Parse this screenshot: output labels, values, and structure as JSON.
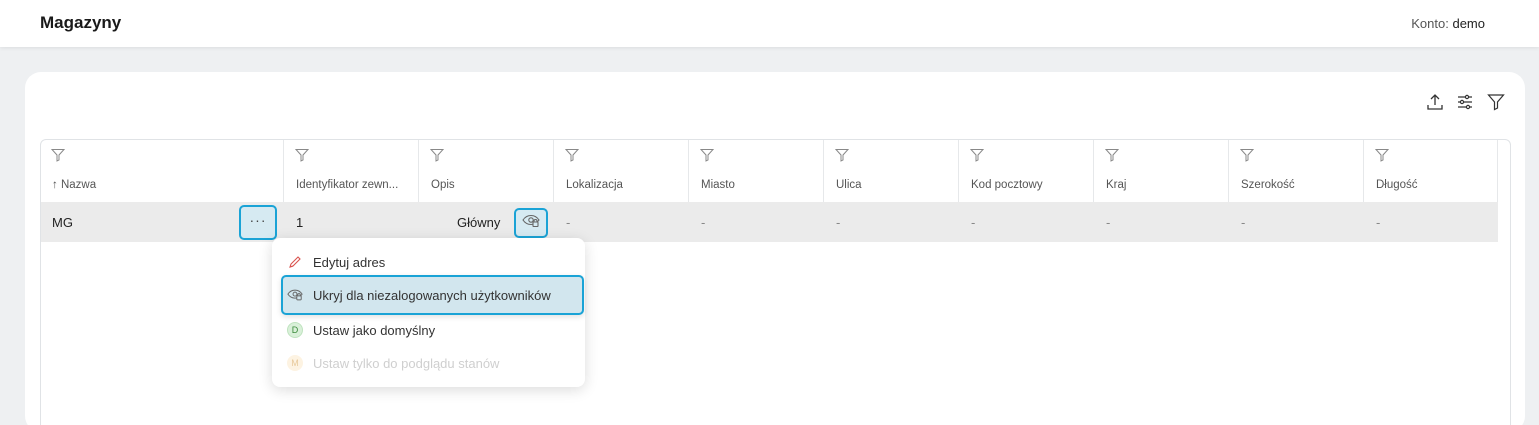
{
  "header": {
    "title": "Magazyny",
    "account_label": "Konto:",
    "account_value": "demo"
  },
  "toolbar": {
    "icons": [
      "upload-icon",
      "settings-sliders-icon",
      "filter-icon"
    ]
  },
  "table": {
    "columns": [
      {
        "label": "↑ Nazwa"
      },
      {
        "label": "Identyfikator zewn..."
      },
      {
        "label": "Opis"
      },
      {
        "label": "Lokalizacja"
      },
      {
        "label": "Miasto"
      },
      {
        "label": "Ulica"
      },
      {
        "label": "Kod pocztowy"
      },
      {
        "label": "Kraj"
      },
      {
        "label": "Szerokość"
      },
      {
        "label": "Długość"
      }
    ],
    "rows": [
      {
        "nazwa": "MG",
        "identyfikator": "1",
        "opis": "Główny",
        "lokalizacja": "-",
        "miasto": "-",
        "ulica": "-",
        "kod": "-",
        "kraj": "-",
        "szerokosc": "-",
        "dlugosc": "-"
      }
    ],
    "row_menu_button": "···"
  },
  "context_menu": {
    "items": [
      {
        "label": "Edytuj adres",
        "icon": "pencil-icon"
      },
      {
        "label": "Ukryj dla niezalogowanych użytkowników",
        "icon": "eye-off-icon"
      },
      {
        "label": "Ustaw jako domyślny",
        "icon": "badge-d-icon",
        "badge": "D"
      },
      {
        "label": "Ustaw tylko do podglądu stanów",
        "icon": "badge-m-icon",
        "badge": "M"
      }
    ]
  },
  "colors": {
    "accent": "#1aa3d6",
    "highlight_bg": "#d6eaf2",
    "row_bg": "#ebebeb"
  }
}
